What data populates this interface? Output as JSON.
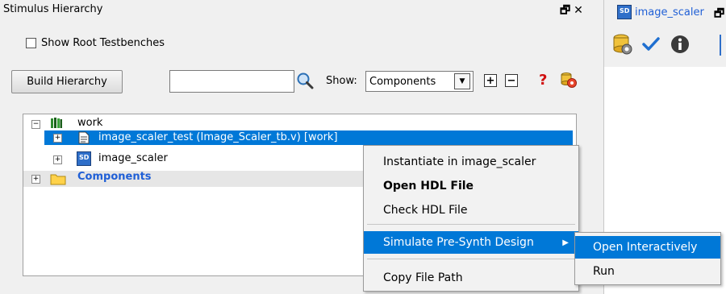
{
  "stimulus_pane": {
    "title": "Stimulus Hierarchy",
    "show_root_label": "Show Root Testbenches",
    "build_button_label": "Build Hierarchy",
    "filter_value": "",
    "show_label": "Show:",
    "show_value": "Components",
    "help_glyph": "?"
  },
  "tree": {
    "root_label": "work",
    "items": [
      {
        "label": "image_scaler_test (Image_Scaler_tb.v) [work]",
        "icon": "file-icon"
      },
      {
        "label": "image_scaler",
        "icon": "smartdesign-icon"
      },
      {
        "label": "Components",
        "icon": "folder-icon"
      }
    ]
  },
  "right_pane": {
    "tab_label": "image_scaler"
  },
  "context_menu": {
    "items": [
      {
        "label": "Instantiate in image_scaler"
      },
      {
        "label": "Open HDL File"
      },
      {
        "label": "Check HDL File"
      },
      {
        "label": "Simulate Pre-Synth Design"
      },
      {
        "label": "Copy File Path"
      }
    ]
  },
  "submenu": {
    "items": [
      {
        "label": "Open Interactively"
      },
      {
        "label": "Run"
      }
    ]
  },
  "colors": {
    "selection": "#0078d7",
    "pane_background": "#f0f0f0",
    "link_blue": "#1f5fd6"
  }
}
